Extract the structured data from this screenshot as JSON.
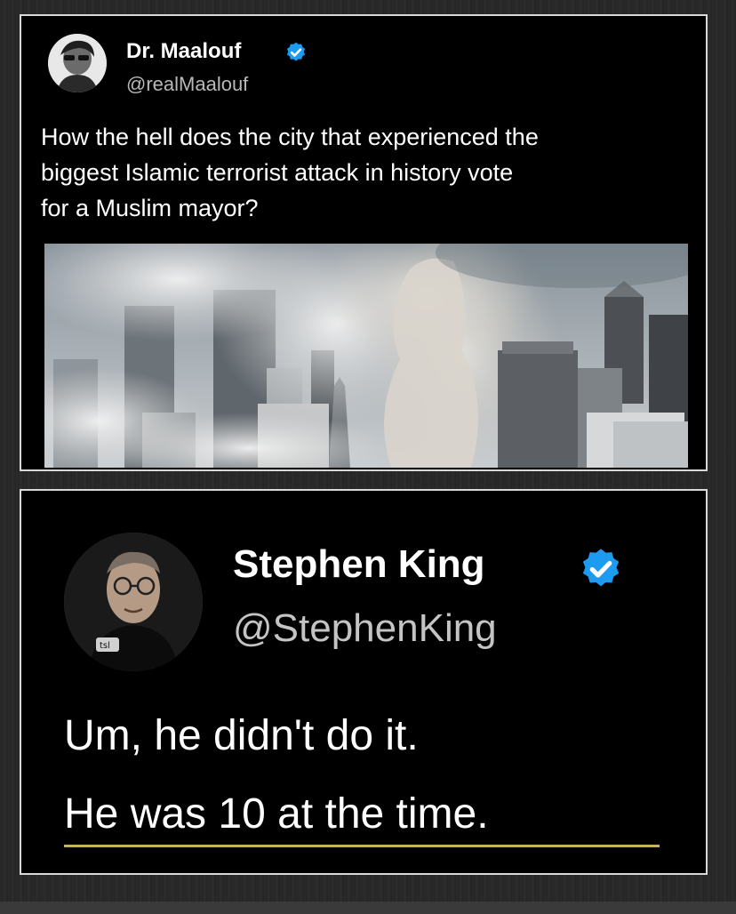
{
  "post1": {
    "author_name": "Dr. Maalouf",
    "author_handle": "@realMaalouf",
    "verified": true,
    "text_lines": [
      "How the hell does the city that experienced the",
      "biggest Islamic terrorist attack in history vote",
      "for a Muslim mayor?"
    ],
    "image_icon": "smoke-city-photo"
  },
  "post2": {
    "author_name": "Stephen King",
    "author_handle": "@StephenKing",
    "verified": true,
    "text_lines": [
      "Um, he didn't do it.",
      "He was 10 at the time."
    ]
  },
  "colors": {
    "badge": "#1d9bf0",
    "card_bg": "#000000",
    "card_border": "#d9d9d9",
    "handle": "#b8b8b8",
    "underline": "#c9b25a"
  }
}
